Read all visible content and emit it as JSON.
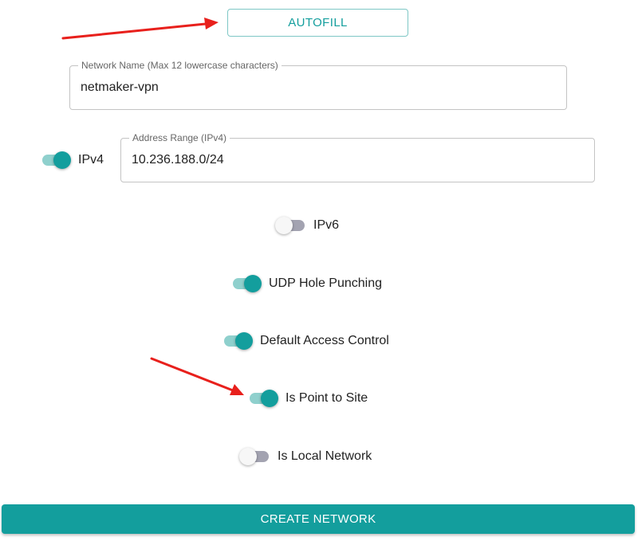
{
  "autofill": {
    "label": "AUTOFILL"
  },
  "network_name": {
    "legend": "Network Name (Max 12 lowercase characters)",
    "value": "netmaker-vpn"
  },
  "ipv4": {
    "toggle_label": "IPv4",
    "enabled": true,
    "range_legend": "Address Range (IPv4)",
    "range_value": "10.236.188.0/24"
  },
  "ipv6": {
    "toggle_label": "IPv6",
    "enabled": false
  },
  "udp_hole_punching": {
    "toggle_label": "UDP Hole Punching",
    "enabled": true
  },
  "default_access_control": {
    "toggle_label": "Default Access Control",
    "enabled": true
  },
  "is_point_to_site": {
    "toggle_label": "Is Point to Site",
    "enabled": true
  },
  "is_local_network": {
    "toggle_label": "Is Local Network",
    "enabled": false
  },
  "create_network": {
    "label": "CREATE NETWORK"
  },
  "colors": {
    "accent": "#139e9d",
    "accent_track": "#8fd0cd",
    "off_track": "#a3a3b1",
    "annotation_arrow": "#e8201c"
  }
}
